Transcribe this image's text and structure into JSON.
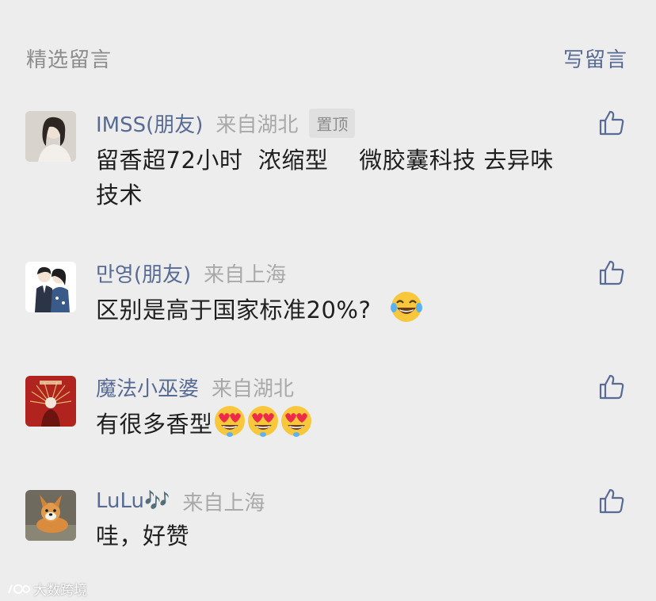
{
  "header": {
    "title": "精选留言",
    "write_label": "写留言"
  },
  "comments": [
    {
      "nickname": "IMSS(朋友)",
      "location": "来自湖北",
      "pinned_label": "置顶",
      "text_line1": "留香超72小时  浓缩型    微胶囊科技 去异味",
      "text_line2": "技术"
    },
    {
      "nickname": "만영(朋友)",
      "location": "来自上海",
      "text": "区别是高于国家标准20%?"
    },
    {
      "nickname": "魔法小巫婆",
      "location": "来自湖北",
      "text": "有很多香型"
    },
    {
      "nickname": "LuLu🎶",
      "location": "来自上海",
      "text": "哇，好赞"
    }
  ],
  "watermark": "大数跨境",
  "colors": {
    "background": "#ededed",
    "nickname": "#576b95",
    "location": "#a9a9a9",
    "text": "#1f1f1f"
  },
  "icons": [
    "thumbs-up-icon",
    "laughing-tears-emoji",
    "heart-eyes-emoji"
  ]
}
